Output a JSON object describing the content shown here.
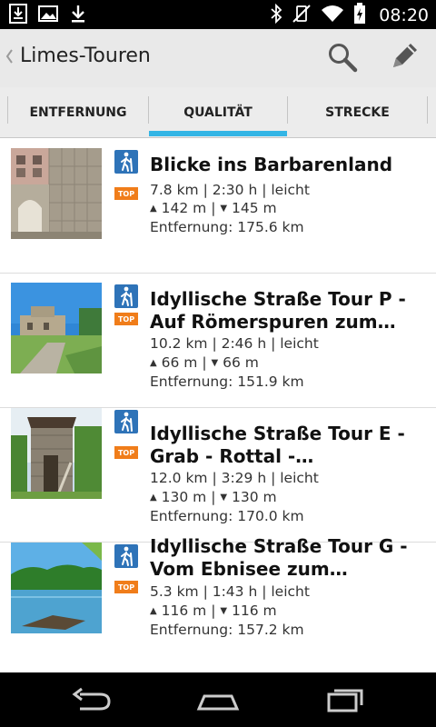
{
  "status_bar": {
    "time": "08:20",
    "left_icons": [
      "download-box-icon",
      "image-icon",
      "download-icon"
    ],
    "right_icons": [
      "bluetooth-icon",
      "vibrate-off-icon",
      "wifi-icon",
      "battery-icon"
    ]
  },
  "action_bar": {
    "title": "Limes-Touren",
    "search_icon": "search-icon",
    "edit_icon": "pencil-icon"
  },
  "tabs": [
    {
      "label": "ENTFERNUNG",
      "selected": false
    },
    {
      "label": "QUALITÄT",
      "selected": true
    },
    {
      "label": "STRECKE",
      "selected": false
    }
  ],
  "colors": {
    "accent": "#33b5e5",
    "hike_icon_bg": "#2e73b8",
    "top_badge_bg": "#f07d1a"
  },
  "tours": [
    {
      "title": "Blicke ins Barbarenland",
      "stats": "7.8 km | 2:30 h | leicht",
      "up": "142 m",
      "down": "145 m",
      "distance": "Entfernung: 175.6 km",
      "badge": "TOP",
      "category_icon": "hiking-icon"
    },
    {
      "title": "Idyllische Straße Tour P - Auf Römerspuren zum…",
      "stats": "10.2 km | 2:46 h | leicht",
      "up": "66 m",
      "down": "66 m",
      "distance": "Entfernung: 151.9 km",
      "badge": "TOP",
      "category_icon": "hiking-icon"
    },
    {
      "title": "Idyllische Straße Tour E - Grab - Rottal - Weltkulturerb…",
      "stats": "12.0 km | 3:29 h | leicht",
      "up": "130 m",
      "down": "130 m",
      "distance": "Entfernung: 170.0 km",
      "badge": "TOP",
      "category_icon": "hiking-icon"
    },
    {
      "title": "Idyllische Straße Tour G - Vom Ebnisee zum Welterbe…",
      "stats": "5.3 km | 1:43 h | leicht",
      "up": "116 m",
      "down": "116 m",
      "distance": "Entfernung: 157.2 km",
      "badge": "TOP",
      "category_icon": "hiking-icon"
    }
  ],
  "nav_bar": {
    "icons": [
      "back-icon",
      "home-icon",
      "recent-apps-icon"
    ]
  }
}
